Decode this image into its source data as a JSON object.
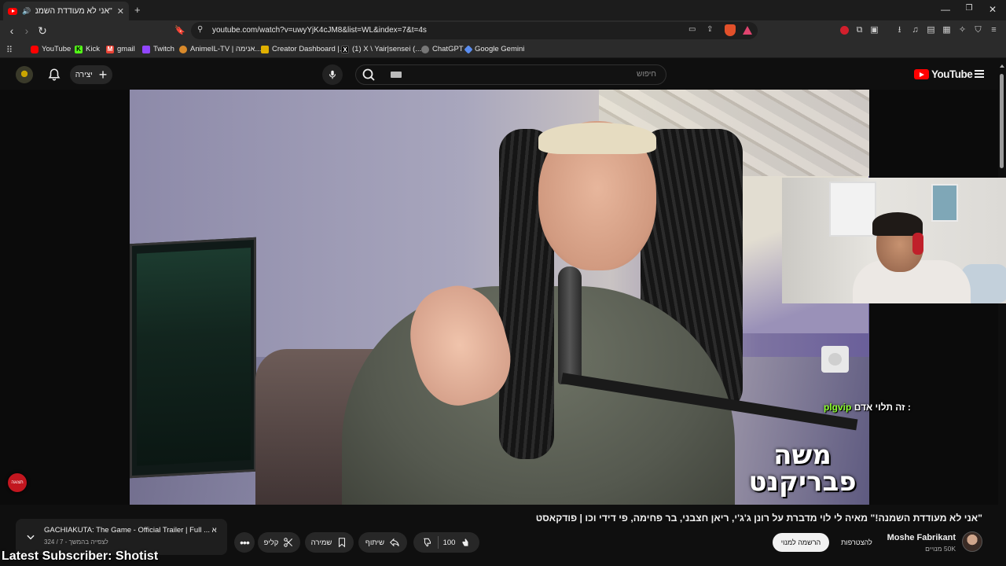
{
  "browser": {
    "tab_title": "\"אני לא מעודדת השמנה\" מאיה",
    "url": "youtube.com/watch?v=uwyYjK4cJM8&list=WL&index=7&t=4s",
    "bookmarks": [
      {
        "label": "YouTube",
        "icon": "youtube-icon",
        "color": "#ff0000"
      },
      {
        "label": "Kick",
        "icon": "kick-icon",
        "color": "#53fc18"
      },
      {
        "label": "gmail",
        "icon": "gmail-icon",
        "color": "#ea4335"
      },
      {
        "label": "Twitch",
        "icon": "twitch-icon",
        "color": "#9146ff"
      },
      {
        "label": "AnimeIL-TV | אנימה...",
        "icon": "animeil-icon",
        "color": "#d98a2b"
      },
      {
        "label": "Creator Dashboard |...",
        "icon": "creator-icon",
        "color": "#e0b000"
      },
      {
        "label": "(1) X \\ Yair|sensei (...",
        "icon": "x-icon",
        "color": "#000000"
      },
      {
        "label": "ChatGPT",
        "icon": "chatgpt-icon",
        "color": "#777777"
      },
      {
        "label": "Google Gemini",
        "icon": "gemini-icon",
        "color": "#5b8def"
      }
    ]
  },
  "youtube": {
    "create_label": "יצירה",
    "search_placeholder": "חיפוש",
    "logo_text": "YouTube"
  },
  "video": {
    "watermark": "משה פבריקנט",
    "chat_message": "זה תלוי אדם :",
    "chat_user": "plgvip",
    "alert_badge": "תצוגה",
    "title": "\"אני לא מעודדת השמנה!\" מאיה לי לוי מדברת על רונן ג'ג'י, ריאן חצבני, בר פחימה, פי דידי וכו | פודקאסט"
  },
  "channel": {
    "name": "Moshe Fabrikant",
    "subscribers": "50K מנויים",
    "join_label": "להצטרפות",
    "subscribe_label": "הרשמה למנוי"
  },
  "actions": {
    "like_count": "100",
    "share_label": "שיתוף",
    "save_label": "שמירה",
    "clip_label": "קליפ"
  },
  "playlist": {
    "title": "GACHIAKUTA: The Game - Official Trailer | Full ... הבא:",
    "subtitle": "לצפייה בהמשך - 7 / 324"
  },
  "overlay": {
    "latest_subscriber": "Latest Subscriber: Shotist"
  }
}
